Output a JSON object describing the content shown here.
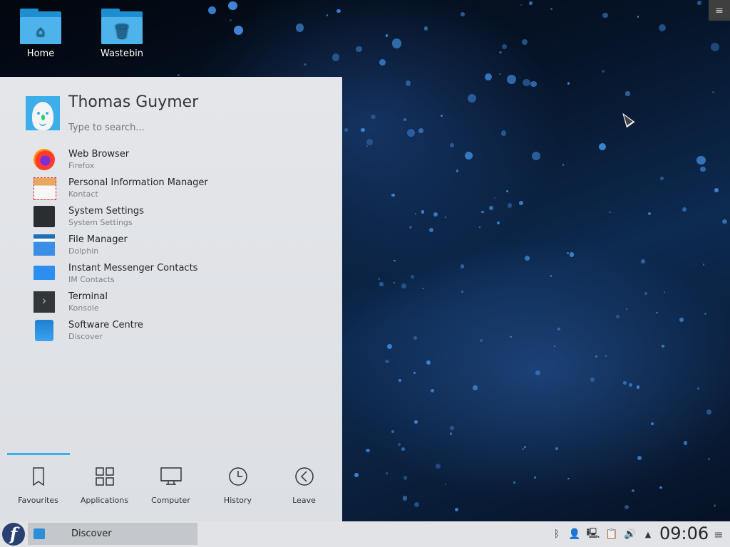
{
  "desktop": {
    "icons": [
      {
        "label": "Home",
        "icon": "home-folder-icon"
      },
      {
        "label": "Wastebin",
        "icon": "trash-folder-icon"
      }
    ],
    "toolbox_icon": "hamburger-menu-icon"
  },
  "launcher": {
    "user_name": "Thomas Guymer",
    "search_placeholder": "Type to search...",
    "favourites": [
      {
        "name": "Web Browser",
        "app": "Firefox",
        "icon": "firefox-icon"
      },
      {
        "name": "Personal Information Manager",
        "app": "Kontact",
        "icon": "kontact-icon"
      },
      {
        "name": "System Settings",
        "app": "System Settings",
        "icon": "system-settings-icon"
      },
      {
        "name": "File Manager",
        "app": "Dolphin",
        "icon": "dolphin-folder-icon"
      },
      {
        "name": "Instant Messenger Contacts",
        "app": "IM Contacts",
        "icon": "chat-bubble-icon"
      },
      {
        "name": "Terminal",
        "app": "Konsole",
        "icon": "terminal-icon"
      },
      {
        "name": "Software Centre",
        "app": "Discover",
        "icon": "discover-bag-icon"
      }
    ],
    "tabs": [
      {
        "label": "Favourites",
        "icon": "bookmark-icon",
        "active": true
      },
      {
        "label": "Applications",
        "icon": "grid-icon",
        "active": false
      },
      {
        "label": "Computer",
        "icon": "monitor-icon",
        "active": false
      },
      {
        "label": "History",
        "icon": "clock-icon",
        "active": false
      },
      {
        "label": "Leave",
        "icon": "arrow-left-circle-icon",
        "active": false
      }
    ],
    "accent_color": "#3daee9"
  },
  "panel": {
    "start_icon": "fedora-logo-icon",
    "task": {
      "label": "Discover",
      "icon": "discover-bag-icon"
    },
    "tray": [
      "bluetooth-icon",
      "user-presence-icon",
      "network-icon",
      "clipboard-icon",
      "volume-icon",
      "expand-arrow-icon"
    ],
    "clock": "09:06",
    "menu_icon": "hamburger-menu-icon"
  }
}
